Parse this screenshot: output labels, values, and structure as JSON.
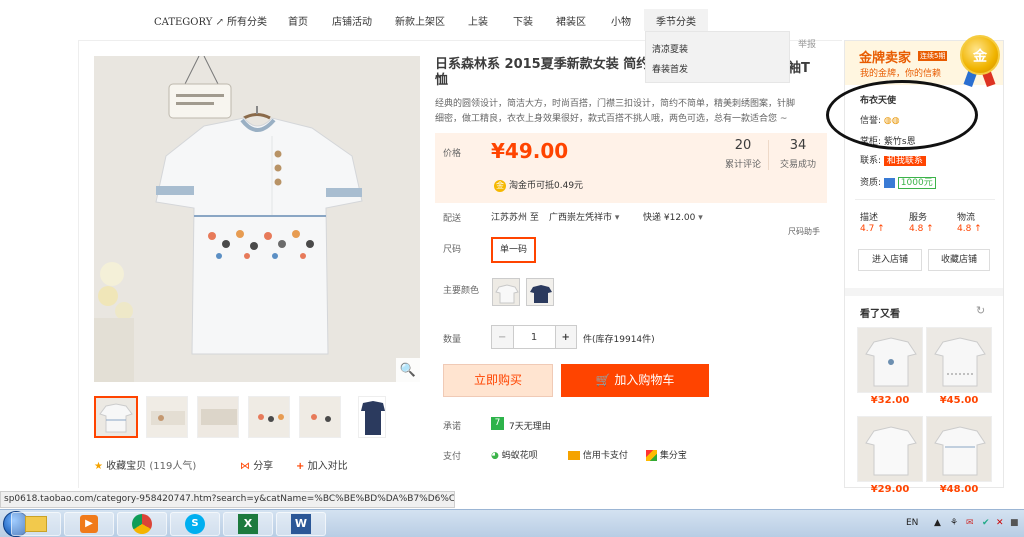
{
  "nav": {
    "items": [
      "CATEGORY ↗ 所有分类",
      "首页",
      "店铺活动",
      "新款上架区",
      "上装",
      "下装",
      "裙装区",
      "小物",
      "季节分类"
    ],
    "dropdown": [
      "清凉夏装",
      "春装首发"
    ],
    "report": "举报"
  },
  "product": {
    "title": "日系森林系 2015夏季新款女装 简约",
    "title_tail": "袖T",
    "title_line2": "恤",
    "description": "经典的圆领设计，简洁大方，时尚百搭，门襟三扣设计，简约不简单，精美刺绣图案，针脚",
    "description_line2": "细密，做工精良，衣衣上身效果很好，款式百搭不挑人哦，两色可选，总有一款适合您 ~",
    "price_label": "价格",
    "price": "¥49.00",
    "reviews_count": "20",
    "reviews_label": "累计评论",
    "sales_count": "34",
    "sales_label": "交易成功",
    "coin_text": "淘金币可抵0.49元",
    "coin_icon": "金",
    "ship_label": "配送",
    "ship_from": "江苏苏州 至",
    "ship_to": "广西崇左凭祥市",
    "ship_method": "快递 ¥12.00",
    "size_helper": "尺码助手",
    "size_label": "尺码",
    "size_value": "单一码",
    "color_label": "主要颜色",
    "qty_label": "数量",
    "qty_value": "1",
    "qty_minus": "−",
    "qty_plus": "+",
    "stock_text": "件(库存19914件)",
    "buy_now": "立即购买",
    "add_to_cart": "加入购物车",
    "promise_label": "承诺",
    "promise_icon": "7",
    "promise_text": "7天无理由",
    "pay_label": "支付",
    "pay_methods": [
      "蚂蚁花呗",
      "信用卡支付",
      "集分宝"
    ],
    "favorite": "收藏宝贝",
    "favorite_count": "(119人气)",
    "share": "分享",
    "compare": "加入对比"
  },
  "seller": {
    "badge_title": "金牌卖家",
    "badge_tag": "连续5期",
    "badge_sub": "我的金牌，你的信赖",
    "medal": "金",
    "shop_name": "布衣天使",
    "credit_label": "信誉:",
    "keeper_label": "掌柜:",
    "keeper_name": "紫竹s恩",
    "contact_label": "联系:",
    "contact_btn": "和我联系",
    "qual_label": "资质:",
    "qual_value": "1000元",
    "scores": [
      {
        "label": "描述",
        "value": "4.7 ↑"
      },
      {
        "label": "服务",
        "value": "4.8 ↑"
      },
      {
        "label": "物流",
        "value": "4.8 ↑"
      }
    ],
    "enter_shop": "进入店铺",
    "fav_shop": "收藏店铺"
  },
  "recommend": {
    "title": "看了又看",
    "refresh": "↻",
    "prices": [
      "¥32.00",
      "¥45.00",
      "¥29.00",
      "¥48.00"
    ]
  },
  "statusbar": {
    "url": "sp0618.taobao.com/category-958420747.htm?search=y&catName=%BC%BE%BD%DA%B7%D6%C0%E0"
  },
  "taskbar": {
    "lang": "EN",
    "apps": [
      "explorer-icon",
      "media-player-icon",
      "chrome-icon",
      "skype-icon",
      "excel-icon",
      "word-icon"
    ],
    "tray": [
      "▲",
      "⚘",
      "✉",
      "✔",
      "✕",
      "■"
    ]
  },
  "colors": {
    "accent": "#ff4400",
    "price_bg": "#fff2e8",
    "gold": "#f0b400"
  }
}
